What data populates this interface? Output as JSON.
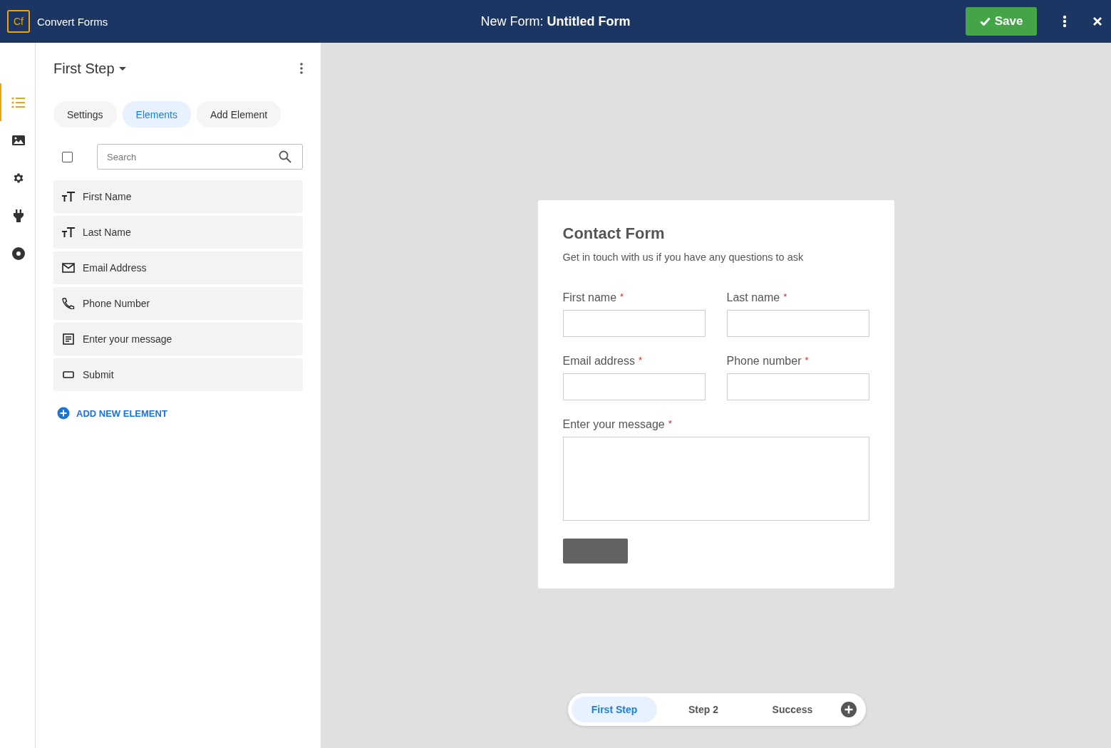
{
  "header": {
    "logo": "Cf",
    "app_name": "Convert Forms",
    "title": "New Form: **Untitled Form**",
    "save_label": "Save"
  },
  "rail": [
    {
      "kind": "list",
      "selected": true
    },
    {
      "kind": "image",
      "selected": false
    },
    {
      "kind": "gear",
      "selected": false
    },
    {
      "kind": "plug",
      "selected": false
    },
    {
      "kind": "disc",
      "selected": false
    }
  ],
  "panel": {
    "step_title": "First Step",
    "tabs": [
      {
        "label": "Settings",
        "selected": false
      },
      {
        "label": "Elements",
        "selected": true
      },
      {
        "label": "Add Element",
        "selected": false
      }
    ],
    "select_all": {
      "checked": false
    },
    "search": {
      "placeholder": "Search"
    },
    "elements": [
      {
        "kind": "text",
        "label": "First Name"
      },
      {
        "kind": "text",
        "label": "Last Name"
      },
      {
        "kind": "email",
        "label": "Email Address"
      },
      {
        "kind": "phone",
        "label": "Phone Number"
      },
      {
        "kind": "textarea",
        "label": "Enter your message"
      },
      {
        "kind": "submit",
        "label": "Submit"
      }
    ],
    "add_label": "ADD NEW ELEMENT"
  },
  "form": {
    "title": "Contact Form",
    "required_mark": "*",
    "subtitle": "Get in touch with us if you have any questions to ask",
    "fields": [
      {
        "kind": "input",
        "label": "First name",
        "required": true
      },
      {
        "kind": "input",
        "label": "Last name",
        "required": true
      },
      {
        "kind": "input",
        "label": "Email address",
        "required": true
      },
      {
        "kind": "input",
        "label": "Phone number",
        "required": true
      },
      {
        "kind": "textarea",
        "label": "Enter your message",
        "required": true
      }
    ]
  },
  "steps": [
    {
      "label": "First Step",
      "selected": true
    },
    {
      "label": "Step 2",
      "selected": false
    },
    {
      "label": "Success",
      "selected": false
    }
  ]
}
